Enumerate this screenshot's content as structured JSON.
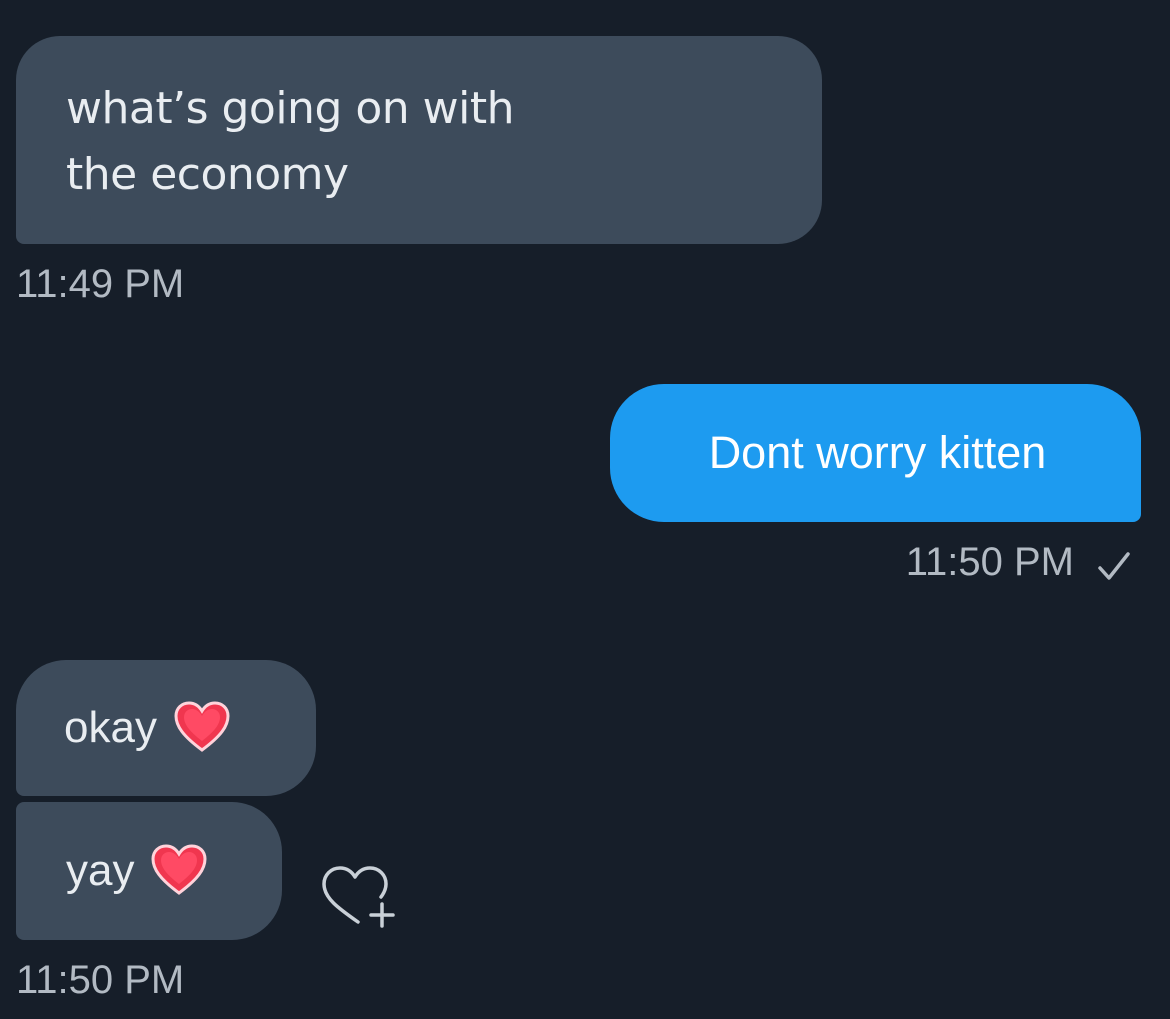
{
  "messages": [
    {
      "direction": "incoming",
      "lines": [
        "what’s going on with",
        "the economy"
      ],
      "time": "11:49 PM"
    },
    {
      "direction": "outgoing",
      "text": "Dont worry kitten",
      "time": "11:50 PM",
      "status_icon": "check-icon"
    },
    {
      "direction": "incoming",
      "text": "okay",
      "emoji": "heart-emoji"
    },
    {
      "direction": "incoming",
      "text": "yay",
      "emoji": "heart-emoji",
      "action_icon": "add-reaction-icon",
      "time": "11:50 PM"
    }
  ],
  "colors": {
    "background": "#161e29",
    "incoming_bubble": "#3d4b5b",
    "outgoing_bubble": "#1d9bf0",
    "timestamp": "#b2bac3",
    "heart": "#f0364f"
  }
}
